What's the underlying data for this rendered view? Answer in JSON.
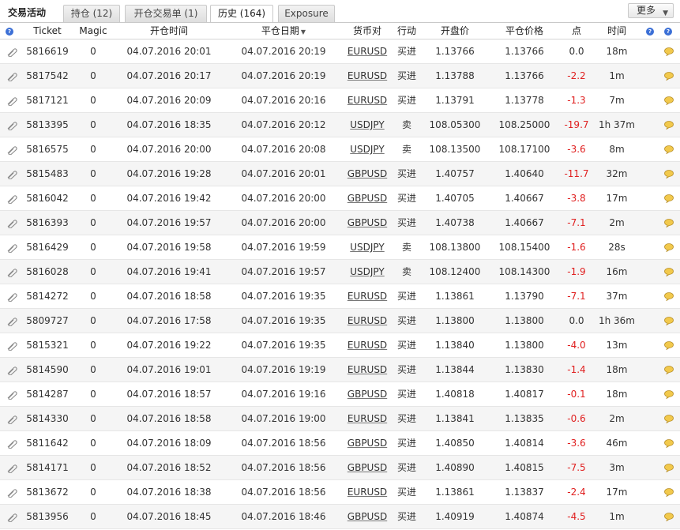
{
  "app": {
    "title": "交易活动",
    "tabs": [
      {
        "label": "持仓 (12)"
      },
      {
        "label": "开仓交易单 (1)"
      },
      {
        "label": "历史 (164)"
      },
      {
        "label": "Exposure"
      }
    ],
    "active_tab": 2,
    "more_label": "更多"
  },
  "table": {
    "headers": {
      "ticket": "Ticket",
      "magic": "Magic",
      "open_time": "开仓时间",
      "close_date": "平仓日期",
      "symbol": "货币对",
      "action": "行动",
      "open_price": "开盘价",
      "close_price": "平仓价格",
      "points": "点",
      "duration": "时间"
    },
    "sorted_by": "close_date",
    "rows": [
      {
        "ticket": "5816619",
        "magic": "0",
        "open_time": "04.07.2016 20:01",
        "close_date": "04.07.2016 20:19",
        "symbol": "EURUSD",
        "action": "买进",
        "open_price": "1.13766",
        "close_price": "1.13766",
        "points": "0.0",
        "duration": "18m"
      },
      {
        "ticket": "5817542",
        "magic": "0",
        "open_time": "04.07.2016 20:17",
        "close_date": "04.07.2016 20:19",
        "symbol": "EURUSD",
        "action": "买进",
        "open_price": "1.13788",
        "close_price": "1.13766",
        "points": "-2.2",
        "duration": "1m"
      },
      {
        "ticket": "5817121",
        "magic": "0",
        "open_time": "04.07.2016 20:09",
        "close_date": "04.07.2016 20:16",
        "symbol": "EURUSD",
        "action": "买进",
        "open_price": "1.13791",
        "close_price": "1.13778",
        "points": "-1.3",
        "duration": "7m"
      },
      {
        "ticket": "5813395",
        "magic": "0",
        "open_time": "04.07.2016 18:35",
        "close_date": "04.07.2016 20:12",
        "symbol": "USDJPY",
        "action": "卖",
        "open_price": "108.05300",
        "close_price": "108.25000",
        "points": "-19.7",
        "duration": "1h 37m"
      },
      {
        "ticket": "5816575",
        "magic": "0",
        "open_time": "04.07.2016 20:00",
        "close_date": "04.07.2016 20:08",
        "symbol": "USDJPY",
        "action": "卖",
        "open_price": "108.13500",
        "close_price": "108.17100",
        "points": "-3.6",
        "duration": "8m"
      },
      {
        "ticket": "5815483",
        "magic": "0",
        "open_time": "04.07.2016 19:28",
        "close_date": "04.07.2016 20:01",
        "symbol": "GBPUSD",
        "action": "买进",
        "open_price": "1.40757",
        "close_price": "1.40640",
        "points": "-11.7",
        "duration": "32m"
      },
      {
        "ticket": "5816042",
        "magic": "0",
        "open_time": "04.07.2016 19:42",
        "close_date": "04.07.2016 20:00",
        "symbol": "GBPUSD",
        "action": "买进",
        "open_price": "1.40705",
        "close_price": "1.40667",
        "points": "-3.8",
        "duration": "17m"
      },
      {
        "ticket": "5816393",
        "magic": "0",
        "open_time": "04.07.2016 19:57",
        "close_date": "04.07.2016 20:00",
        "symbol": "GBPUSD",
        "action": "买进",
        "open_price": "1.40738",
        "close_price": "1.40667",
        "points": "-7.1",
        "duration": "2m"
      },
      {
        "ticket": "5816429",
        "magic": "0",
        "open_time": "04.07.2016 19:58",
        "close_date": "04.07.2016 19:59",
        "symbol": "USDJPY",
        "action": "卖",
        "open_price": "108.13800",
        "close_price": "108.15400",
        "points": "-1.6",
        "duration": "28s"
      },
      {
        "ticket": "5816028",
        "magic": "0",
        "open_time": "04.07.2016 19:41",
        "close_date": "04.07.2016 19:57",
        "symbol": "USDJPY",
        "action": "卖",
        "open_price": "108.12400",
        "close_price": "108.14300",
        "points": "-1.9",
        "duration": "16m"
      },
      {
        "ticket": "5814272",
        "magic": "0",
        "open_time": "04.07.2016 18:58",
        "close_date": "04.07.2016 19:35",
        "symbol": "EURUSD",
        "action": "买进",
        "open_price": "1.13861",
        "close_price": "1.13790",
        "points": "-7.1",
        "duration": "37m"
      },
      {
        "ticket": "5809727",
        "magic": "0",
        "open_time": "04.07.2016 17:58",
        "close_date": "04.07.2016 19:35",
        "symbol": "EURUSD",
        "action": "买进",
        "open_price": "1.13800",
        "close_price": "1.13800",
        "points": "0.0",
        "duration": "1h 36m"
      },
      {
        "ticket": "5815321",
        "magic": "0",
        "open_time": "04.07.2016 19:22",
        "close_date": "04.07.2016 19:35",
        "symbol": "EURUSD",
        "action": "买进",
        "open_price": "1.13840",
        "close_price": "1.13800",
        "points": "-4.0",
        "duration": "13m"
      },
      {
        "ticket": "5814590",
        "magic": "0",
        "open_time": "04.07.2016 19:01",
        "close_date": "04.07.2016 19:19",
        "symbol": "EURUSD",
        "action": "买进",
        "open_price": "1.13844",
        "close_price": "1.13830",
        "points": "-1.4",
        "duration": "18m"
      },
      {
        "ticket": "5814287",
        "magic": "0",
        "open_time": "04.07.2016 18:57",
        "close_date": "04.07.2016 19:16",
        "symbol": "GBPUSD",
        "action": "买进",
        "open_price": "1.40818",
        "close_price": "1.40817",
        "points": "-0.1",
        "duration": "18m"
      },
      {
        "ticket": "5814330",
        "magic": "0",
        "open_time": "04.07.2016 18:58",
        "close_date": "04.07.2016 19:00",
        "symbol": "EURUSD",
        "action": "买进",
        "open_price": "1.13841",
        "close_price": "1.13835",
        "points": "-0.6",
        "duration": "2m"
      },
      {
        "ticket": "5811642",
        "magic": "0",
        "open_time": "04.07.2016 18:09",
        "close_date": "04.07.2016 18:56",
        "symbol": "GBPUSD",
        "action": "买进",
        "open_price": "1.40850",
        "close_price": "1.40814",
        "points": "-3.6",
        "duration": "46m"
      },
      {
        "ticket": "5814171",
        "magic": "0",
        "open_time": "04.07.2016 18:52",
        "close_date": "04.07.2016 18:56",
        "symbol": "GBPUSD",
        "action": "买进",
        "open_price": "1.40890",
        "close_price": "1.40815",
        "points": "-7.5",
        "duration": "3m"
      },
      {
        "ticket": "5813672",
        "magic": "0",
        "open_time": "04.07.2016 18:38",
        "close_date": "04.07.2016 18:56",
        "symbol": "EURUSD",
        "action": "买进",
        "open_price": "1.13861",
        "close_price": "1.13837",
        "points": "-2.4",
        "duration": "17m"
      },
      {
        "ticket": "5813956",
        "magic": "0",
        "open_time": "04.07.2016 18:45",
        "close_date": "04.07.2016 18:46",
        "symbol": "GBPUSD",
        "action": "买进",
        "open_price": "1.40919",
        "close_price": "1.40874",
        "points": "-4.5",
        "duration": "1m"
      }
    ]
  },
  "colors": {
    "negative": "#e02020",
    "help_icon": "#3b6fd6",
    "row_alt": "#f5f5f5"
  },
  "icons": {
    "help": "help-icon",
    "row_attachment": "paperclip-icon",
    "row_comment": "speech-bubble-icon",
    "more_dropdown": "triangle-down-icon",
    "sort_desc": "sort-desc-icon"
  }
}
